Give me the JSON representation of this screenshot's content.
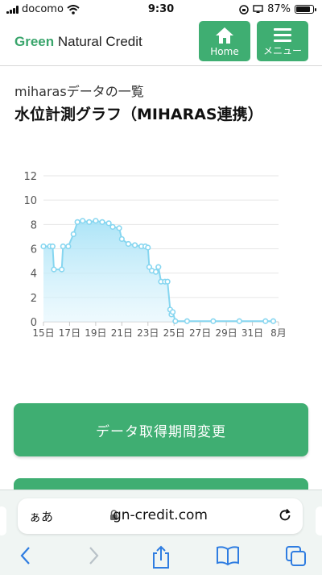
{
  "statusbar": {
    "carrier": "docomo",
    "time": "9:30",
    "battery": "87%",
    "battery_level": 0.87
  },
  "header": {
    "brand_green": "Green",
    "brand_rest": " Natural Credit",
    "home_label": "Home",
    "menu_label": "メニュー",
    "accent_color": "#3fae72"
  },
  "page": {
    "subtitle": "miharasデータの一覧",
    "title": "水位計測グラフ（MIHARAS連携）"
  },
  "chart_data": {
    "type": "area",
    "ylim": [
      0,
      12
    ],
    "yticks": [
      "0",
      "2",
      "4",
      "6",
      "8",
      "10",
      "12"
    ],
    "xticks": [
      "15日",
      "17日",
      "19日",
      "21日",
      "23日",
      "25日",
      "27日",
      "29日",
      "31日",
      "8月"
    ],
    "grid": true,
    "legend": "none",
    "series_color": "#86d6f0",
    "x": [
      15.0,
      15.5,
      15.7,
      15.8,
      16.4,
      16.5,
      16.9,
      17.3,
      17.6,
      18.0,
      18.5,
      19.0,
      19.5,
      20.0,
      20.3,
      20.8,
      21.0,
      21.5,
      22.0,
      22.5,
      22.8,
      23.0,
      23.1,
      23.3,
      23.6,
      23.8,
      24.0,
      24.3,
      24.5,
      24.7,
      24.8,
      24.9,
      25.1,
      26.0,
      28.0,
      30.0,
      32.0,
      32.6
    ],
    "y": [
      6.2,
      6.2,
      6.2,
      4.3,
      4.3,
      6.2,
      6.2,
      7.2,
      8.2,
      8.3,
      8.2,
      8.3,
      8.2,
      8.1,
      7.8,
      7.7,
      6.8,
      6.4,
      6.3,
      6.2,
      6.2,
      6.1,
      4.5,
      4.2,
      4.1,
      4.5,
      3.3,
      3.3,
      3.3,
      1.0,
      0.6,
      0.8,
      0.05,
      0.05,
      0.05,
      0.05,
      0.05,
      0.05
    ]
  },
  "buttons": {
    "change_period": "データ取得期間変更"
  },
  "browser": {
    "text_size": "ぁあ",
    "domain": "gn-credit.com"
  }
}
